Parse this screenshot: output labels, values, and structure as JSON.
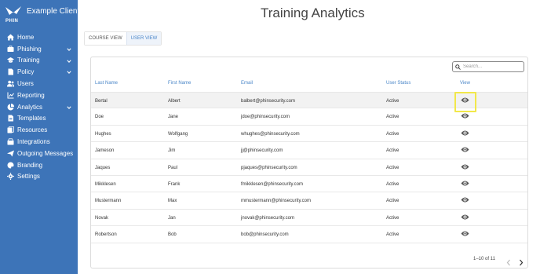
{
  "brand": {
    "logo_text": "PHIN",
    "client_name": "Example Client"
  },
  "sidebar": {
    "items": [
      {
        "label": "Home",
        "icon": "home-icon",
        "chevron": false
      },
      {
        "label": "Phishing",
        "icon": "phishing-icon",
        "chevron": true
      },
      {
        "label": "Training",
        "icon": "graduation-cap-icon",
        "chevron": true
      },
      {
        "label": "Policy",
        "icon": "policy-icon",
        "chevron": true
      },
      {
        "label": "Users",
        "icon": "users-icon",
        "chevron": false
      },
      {
        "label": "Reporting",
        "icon": "reporting-icon",
        "chevron": false
      },
      {
        "label": "Analytics",
        "icon": "analytics-icon",
        "chevron": true
      },
      {
        "label": "Templates",
        "icon": "templates-icon",
        "chevron": false
      },
      {
        "label": "Resources",
        "icon": "resources-icon",
        "chevron": false
      },
      {
        "label": "Integrations",
        "icon": "integrations-icon",
        "chevron": false
      },
      {
        "label": "Outgoing Messages",
        "icon": "send-icon",
        "chevron": false
      },
      {
        "label": "Branding",
        "icon": "palette-icon",
        "chevron": false
      },
      {
        "label": "Settings",
        "icon": "gear-icon",
        "chevron": false
      }
    ]
  },
  "main": {
    "title": "Training Analytics",
    "tabs": [
      {
        "label": "COURSE VIEW",
        "active": false
      },
      {
        "label": "USER VIEW",
        "active": true
      }
    ],
    "search": {
      "placeholder": "Search..."
    },
    "columns": [
      "Last Name",
      "First Name",
      "Email",
      "User Status",
      "View"
    ],
    "rows": [
      {
        "last": "Bertal",
        "first": "Albert",
        "email": "balbert@phinsecurity.com",
        "status": "Active",
        "highlighted": true
      },
      {
        "last": "Doe",
        "first": "Jane",
        "email": "jdoe@phinsecurity.com",
        "status": "Active",
        "highlighted": false
      },
      {
        "last": "Hughes",
        "first": "Wolfgang",
        "email": "whughes@phinsecurity.com",
        "status": "Active",
        "highlighted": false
      },
      {
        "last": "Jameson",
        "first": "Jim",
        "email": "jj@phinsecurity.com",
        "status": "Active",
        "highlighted": false
      },
      {
        "last": "Jaques",
        "first": "Paul",
        "email": "pjaques@phinsecurity.com",
        "status": "Active",
        "highlighted": false
      },
      {
        "last": "Mikklesen",
        "first": "Frank",
        "email": "fmikklesen@phinsecurity.com",
        "status": "Active",
        "highlighted": false
      },
      {
        "last": "Mustermann",
        "first": "Max",
        "email": "mmustermann@phinsecurity.com",
        "status": "Active",
        "highlighted": false
      },
      {
        "last": "Novak",
        "first": "Jan",
        "email": "jnovak@phinsecurity.com",
        "status": "Active",
        "highlighted": false
      },
      {
        "last": "Robertson",
        "first": "Bob",
        "email": "bob@phinsecurity.com",
        "status": "Active",
        "highlighted": false
      }
    ],
    "pagination": {
      "text": "1–10 of 11"
    }
  },
  "colors": {
    "sidebar_bg": "#3d74b8",
    "accent": "#4a86c8",
    "highlight_box": "#f2e84a"
  }
}
